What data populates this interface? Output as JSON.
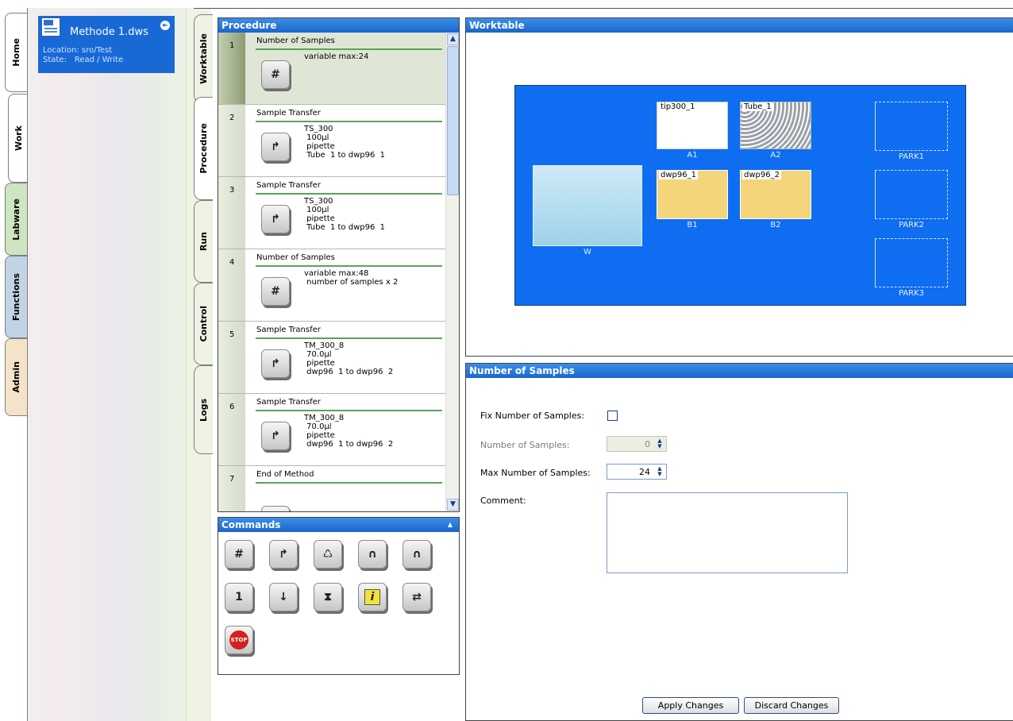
{
  "left_tabs": {
    "home": "Home",
    "work": "Work",
    "labware": "Labware",
    "functions": "Functions",
    "admin": "Admin"
  },
  "file": {
    "name": "Methode 1.dws",
    "location_label": "Location:",
    "location": "sro/Test",
    "state_label": "State:",
    "state": "Read / Write"
  },
  "inner_tabs": {
    "worktable": "Worktable",
    "procedure": "Procedure",
    "run": "Run",
    "control": "Control",
    "logs": "Logs"
  },
  "procedure": {
    "title": "Procedure",
    "steps": [
      {
        "num": "1",
        "title": "Number of Samples",
        "desc": "variable max:24",
        "icon": "number-of-samples-icon"
      },
      {
        "num": "2",
        "title": "Sample Transfer",
        "desc": "TS_300\n 100µl\n pipette\n Tube  1 to dwp96  1",
        "icon": "sample-transfer-icon"
      },
      {
        "num": "3",
        "title": "Sample Transfer",
        "desc": "TS_300\n 100µl\n pipette\n Tube  1 to dwp96  1",
        "icon": "sample-transfer-icon"
      },
      {
        "num": "4",
        "title": "Number of Samples",
        "desc": "variable max:48\n number of samples x 2",
        "icon": "number-of-samples-icon"
      },
      {
        "num": "5",
        "title": "Sample Transfer",
        "desc": "TM_300_8\n 70.0µl\n pipette\n dwp96  1 to dwp96  2",
        "icon": "sample-transfer-icon"
      },
      {
        "num": "6",
        "title": "Sample Transfer",
        "desc": "TM_300_8\n 70.0µl\n pipette\n dwp96  1 to dwp96  2",
        "icon": "sample-transfer-icon"
      },
      {
        "num": "7",
        "title": "End of Method",
        "desc": "",
        "icon": "end-of-method-icon"
      }
    ]
  },
  "commands": {
    "title": "Commands",
    "icons": [
      "number-of-samples-icon",
      "sample-transfer-icon",
      "mix-icon",
      "thermomixer-icon",
      "transfer-tube-icon",
      "reagent-transfer-icon",
      "vacuum-icon",
      "wait-icon",
      "info-icon",
      "exchange-icon",
      "stop-icon"
    ],
    "glyphs": [
      "#",
      "↱",
      "♺",
      "∩",
      "∩",
      "1",
      "↓",
      "⧗",
      "i",
      "⇄",
      "STOP"
    ]
  },
  "worktable": {
    "title": "Worktable",
    "plates": {
      "tip300_1": "tip300_1",
      "tube_1": "Tube_1",
      "dwp96_1": "dwp96_1",
      "dwp96_2": "dwp96_2"
    },
    "slots": {
      "a1": "A1",
      "a2": "A2",
      "b1": "B1",
      "b2": "B2",
      "w": "W",
      "park1": "PARK1",
      "park2": "PARK2",
      "park3": "PARK3"
    },
    "colors": {
      "deck": "#0e6df0",
      "tip_rack": "#ffffff",
      "tube_rack": "#9aa0a8",
      "plate": "#f5d57b"
    }
  },
  "nos_panel": {
    "title": "Number of Samples",
    "fix_label": "Fix Number of Samples:",
    "fix_checked": false,
    "number_label": "Number of Samples:",
    "number_value": "0",
    "max_label": "Max Number of Samples:",
    "max_value": "24",
    "comment_label": "Comment:",
    "comment_value": "",
    "apply": "Apply Changes",
    "discard": "Discard Changes"
  }
}
